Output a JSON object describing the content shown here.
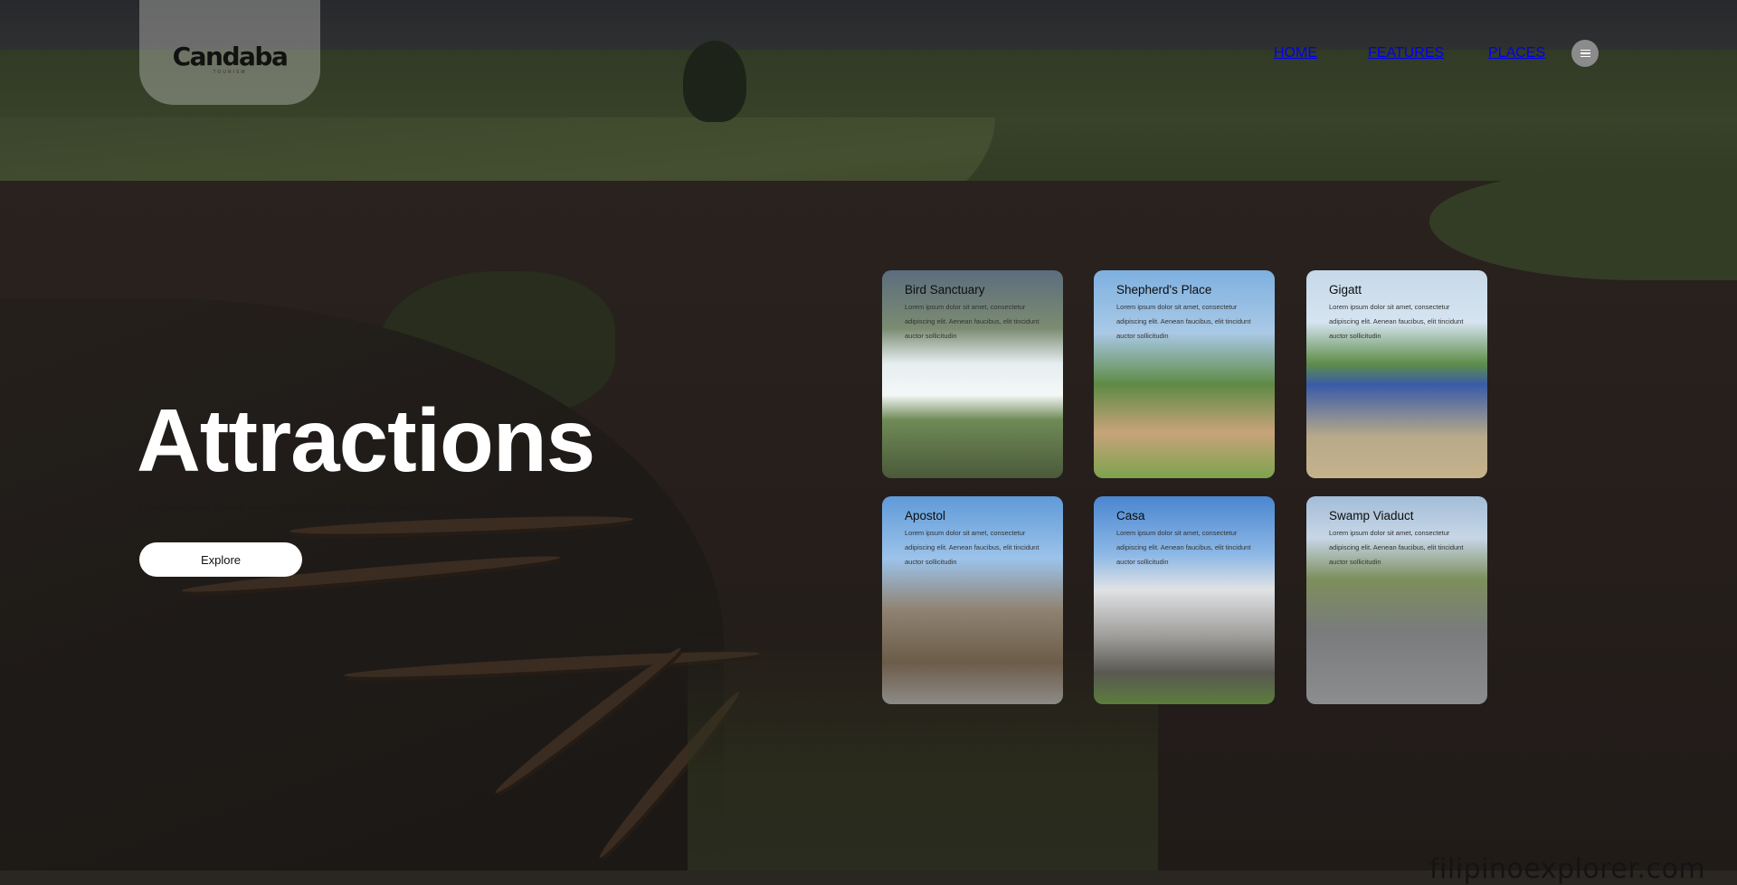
{
  "header": {
    "logo": "Candaba",
    "logo_sub": "TOURISM",
    "nav": {
      "home": "HOME",
      "features": "FEATURES",
      "places": "PLACES"
    },
    "menu_icon": "hamburger-icon"
  },
  "hero": {
    "title": "Attractions",
    "text": "Lorem ipsum dolor sit amet, consectetur adipiscing elit. Aenean faucibus, elit tincidunt auctor sollicitudin",
    "button": "Explore"
  },
  "cards": [
    {
      "title": "Bird Sanctuary",
      "desc": "Lorem ipsum dolor sit amet, consectetur adipiscing elit. Aenean faucibus, elit tincidunt auctor sollicitudin"
    },
    {
      "title": "Shepherd's Place",
      "desc": "Lorem ipsum dolor sit amet, consectetur adipiscing elit. Aenean faucibus, elit tincidunt auctor sollicitudin"
    },
    {
      "title": "Gigatt",
      "desc": "Lorem ipsum dolor sit amet, consectetur adipiscing elit. Aenean faucibus, elit tincidunt auctor sollicitudin"
    },
    {
      "title": "Apostol",
      "desc": "Lorem ipsum dolor sit amet, consectetur adipiscing elit. Aenean faucibus, elit tincidunt auctor sollicitudin"
    },
    {
      "title": "Casa",
      "desc": "Lorem ipsum dolor sit amet, consectetur adipiscing elit. Aenean faucibus, elit tincidunt auctor sollicitudin"
    },
    {
      "title": "Swamp Viaduct",
      "desc": "Lorem ipsum dolor sit amet, consectetur adipiscing elit. Aenean faucibus, elit tincidunt auctor sollicitudin"
    }
  ],
  "watermark": "filipinoexplorer.com"
}
